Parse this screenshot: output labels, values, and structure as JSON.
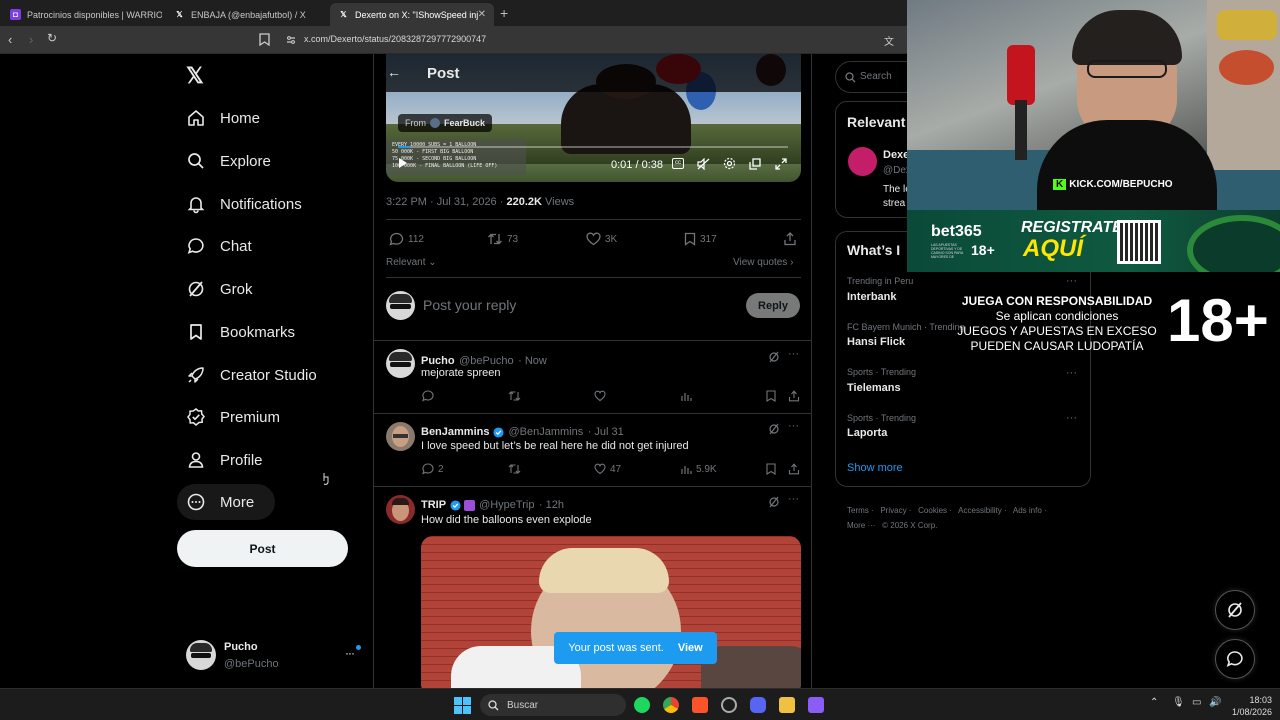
{
  "browser": {
    "tabs": [
      {
        "title": "Patrocinios disponibles | WARRIOR M"
      },
      {
        "title": "ENBAJA (@enbajafutbol) / X"
      },
      {
        "title": "Dexerto on X: \"IShowSpeed inju"
      }
    ],
    "url": "x.com/Dexerto/status/2083287297772900747"
  },
  "nav": {
    "items": [
      {
        "label": "Home"
      },
      {
        "label": "Explore"
      },
      {
        "label": "Notifications"
      },
      {
        "label": "Chat"
      },
      {
        "label": "Grok"
      },
      {
        "label": "Bookmarks"
      },
      {
        "label": "Creator Studio"
      },
      {
        "label": "Premium"
      },
      {
        "label": "Profile"
      },
      {
        "label": "More"
      }
    ],
    "post_button": "Post",
    "account": {
      "name": "Pucho",
      "handle": "@bePucho"
    }
  },
  "header": {
    "title": "Post"
  },
  "video": {
    "from_label": "From",
    "from_name": "FearBuck",
    "overlay_lines": [
      "EVERY 10000 SUBS = 1 BALLOON",
      "50 000K - FIRST BIG BALLOON",
      "75 000K - SECOND BIG BALLOON",
      "100 000K - FINAL BALLOON (LIFE OFF)"
    ],
    "time": "0:01 / 0:38",
    "progress": 0.03
  },
  "post_meta": {
    "timestamp": "3:22 PM · Jul 31, 2026 ·",
    "views_count": "220.2K",
    "views_label": "Views"
  },
  "post_stats": {
    "replies": "112",
    "reposts": "73",
    "likes": "3K",
    "bookmarks": "317"
  },
  "sort": {
    "label": "Relevant",
    "quotes": "View quotes"
  },
  "composer": {
    "placeholder": "Post your reply",
    "button": "Reply"
  },
  "replies": [
    {
      "name": "Pucho",
      "handle": "@bePucho",
      "time": "· Now",
      "text": "mejorate spreen",
      "reply_count": "",
      "like_count": "",
      "view_count": ""
    },
    {
      "name": "BenJammins",
      "handle": "@BenJammins",
      "time": "· Jul 31",
      "text": "I love speed but let’s be real here he did not get injured",
      "reply_count": "2",
      "like_count": "47",
      "view_count": "5.9K"
    },
    {
      "name": "TRIP",
      "handle": "@HypeTrip",
      "time": "· 12h",
      "text": "How did the balloons even explode"
    }
  ],
  "toast": {
    "text": "Your post was sent.",
    "action": "View"
  },
  "right": {
    "search_placeholder": "Search",
    "relevant_title": "Relevant",
    "relevant_name": "Dexe",
    "relevant_handle": "@Dex",
    "relevant_bio": [
      "The le",
      "strea"
    ],
    "whats_title": "What’s I",
    "trends": [
      {
        "category": "Trending in Peru",
        "name": "Interbank"
      },
      {
        "category": "FC Bayern Munich · Trending",
        "name": "Hansi Flick"
      },
      {
        "category": "Sports · Trending",
        "name": "Tielemans"
      },
      {
        "category": "Sports · Trending",
        "name": "Laporta"
      }
    ],
    "show_more": "Show more",
    "footer_links": [
      "Terms",
      "Privacy",
      "Cookies",
      "Accessibility",
      "Ads info",
      "More ···",
      "© 2026 X Corp."
    ]
  },
  "stream": {
    "kick_label": "KICK.COM/BEPUCHO",
    "bet_brand": "bet365",
    "bet_small": "LAS APUESTAS DEPORTIVAS Y DE CASINO SON PARA MAYORES DE",
    "bet_age": "18+",
    "bet_cta_1": "REGISTRATE",
    "bet_cta_2": "AQUÍ",
    "disclaimer_1": "JUEGA CON RESPONSABILIDAD",
    "disclaimer_2": "Se aplican condiciones",
    "disclaimer_3": "JUEGOS Y APUESTAS EN EXCESO",
    "disclaimer_4": "PUEDEN CAUSAR LUDOPATÍA",
    "big_age": "18+"
  },
  "taskbar": {
    "search": "Buscar",
    "time": "18:03",
    "date": "1/08/2026"
  },
  "colors": {
    "accent": "#1d9bf0",
    "background": "#000000",
    "border": "#2f3336",
    "muted": "#71767b",
    "kick_green": "#53fc18"
  }
}
